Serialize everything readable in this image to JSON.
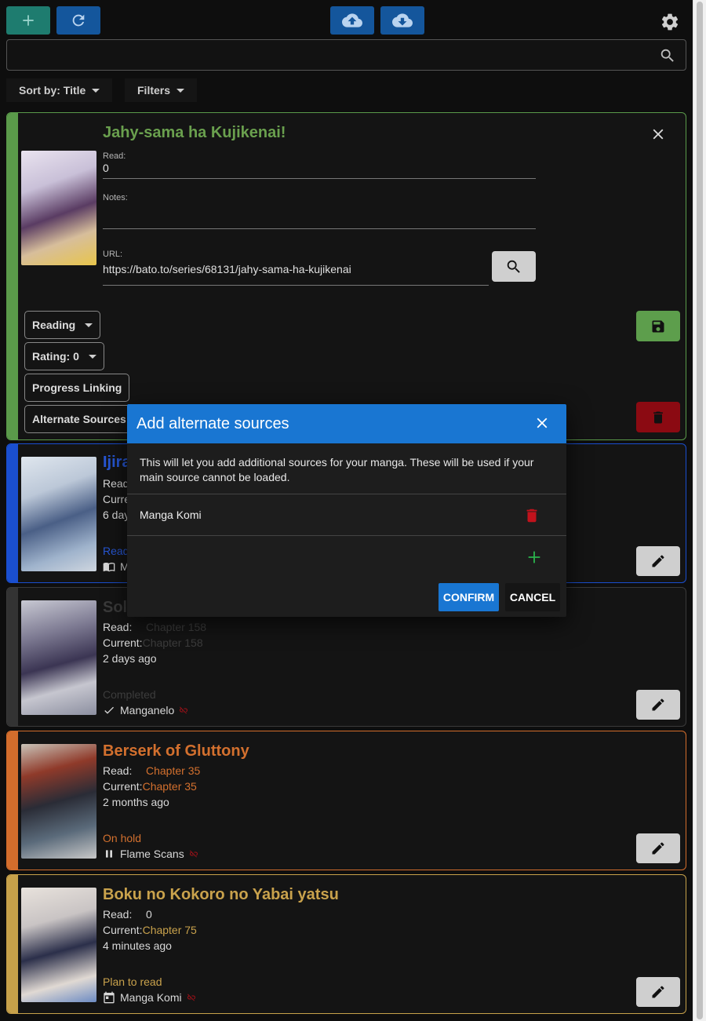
{
  "search": {
    "placeholder": ""
  },
  "sort": {
    "sort_label": "Sort by: Title",
    "filters_label": "Filters"
  },
  "colors": {
    "green": "#5a9a4a",
    "blue": "#1a4fd0",
    "gray": "#3a3a3a",
    "orange": "#d36d2c",
    "gold": "#c7a14a",
    "accent": "#1976d2",
    "delete": "#b3000c"
  },
  "editing_card": {
    "title": "Jahy-sama ha Kujikenai!",
    "read_label": "Read:",
    "read_value": "0",
    "notes_label": "Notes:",
    "notes_value": "",
    "url_label": "URL:",
    "url_value": "https://bato.to/series/68131/jahy-sama-ha-kujikenai",
    "status_select": "Reading",
    "rating_select": "Rating: 0",
    "progress_linking": "Progress Linking",
    "alternate_sources": "Alternate Sources"
  },
  "cards": [
    {
      "title": "Ijira",
      "read_label": "Read",
      "current_label": "Curre",
      "time": "6 day",
      "status": "Read",
      "source": "M"
    },
    {
      "title": "Solo",
      "read_label": "Read:",
      "read_value": "Chapter 158",
      "current_label": "Current:",
      "current_value": "Chapter 158",
      "time": "2 days ago",
      "status": "Completed",
      "source": "Manganelo"
    },
    {
      "title": "Berserk of Gluttony",
      "read_label": "Read:",
      "read_value": "Chapter 35",
      "current_label": "Current:",
      "current_value": "Chapter 35",
      "time": "2 months ago",
      "status": "On hold",
      "source": "Flame Scans"
    },
    {
      "title": "Boku no Kokoro no Yabai yatsu",
      "read_label": "Read:",
      "read_value": "0",
      "current_label": "Current:",
      "current_value": "Chapter 75",
      "time": "4 minutes ago",
      "status": "Plan to read",
      "source": "Manga Komi"
    }
  ],
  "dialog": {
    "title": "Add alternate sources",
    "description": "This will let you add additional sources for your manga. These will be used if your main source cannot be loaded.",
    "sources": [
      "Manga Komi"
    ],
    "confirm": "CONFIRM",
    "cancel": "CANCEL"
  }
}
